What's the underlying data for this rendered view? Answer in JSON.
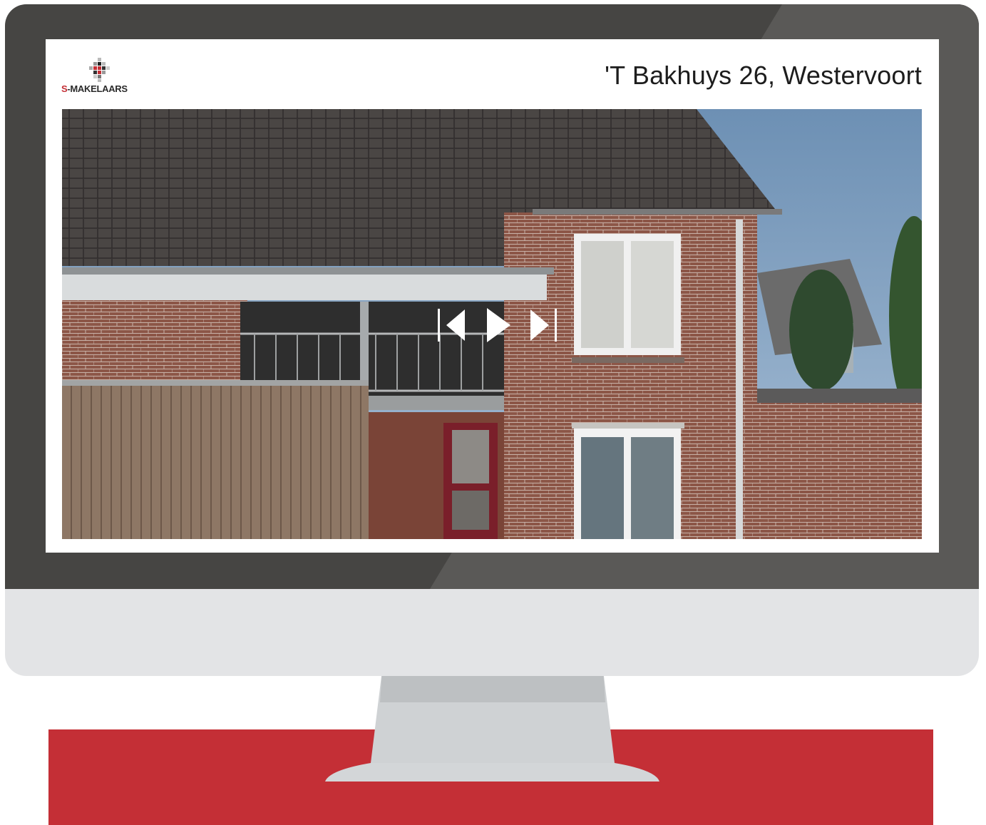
{
  "brand": {
    "logo_prefix": "S",
    "logo_suffix": "-MAKELAARS",
    "accent": "#c42f36"
  },
  "listing": {
    "title": "'T Bakhuys 26, Westervoort"
  },
  "slideshow": {
    "controls": [
      "previous-icon",
      "play-icon",
      "next-icon"
    ]
  },
  "colors": {
    "bezel": "#464543",
    "chassis": "#e3e4e6",
    "stand": "#cdd0d2",
    "band": "#c42f36"
  }
}
